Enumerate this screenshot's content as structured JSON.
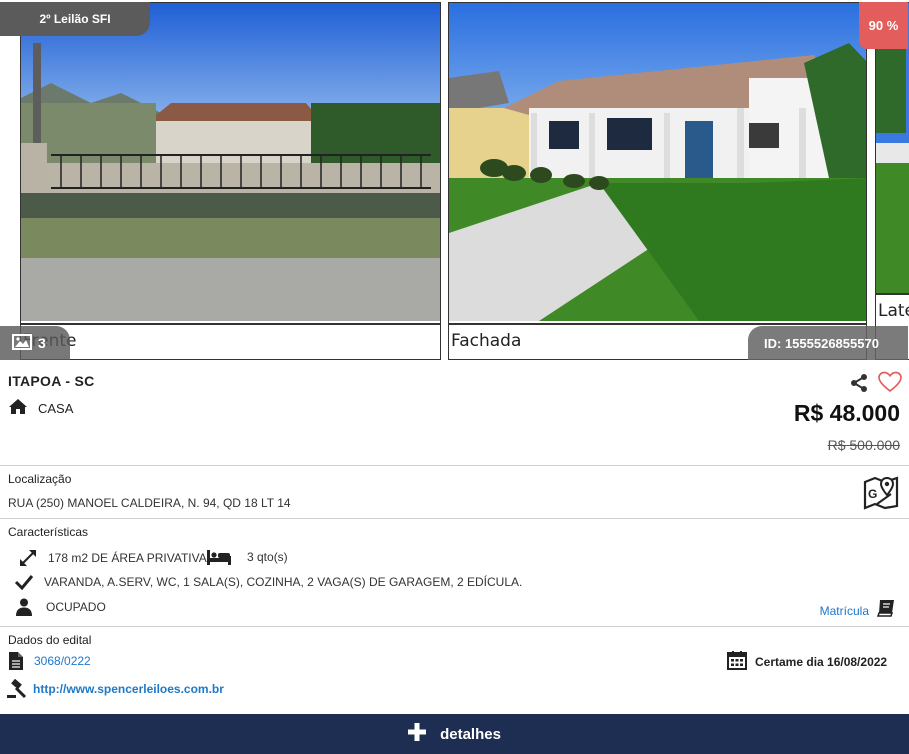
{
  "gallery": {
    "auction_ribbon": "2º Leilão SFI",
    "discount_badge": "90 %",
    "photo_count": "3",
    "id_badge": "ID: 1555526855570",
    "photos": [
      {
        "caption": "Frente",
        "icon": "house-front-photo"
      },
      {
        "caption": "Fachada",
        "icon": "house-facade-photo"
      },
      {
        "caption": "Lateral",
        "icon": "house-side-photo"
      }
    ]
  },
  "listing": {
    "city": "ITAPOA - SC",
    "property_type": "CASA",
    "price": "R$ 48.000",
    "old_price": "R$ 500.000"
  },
  "location": {
    "label": "Localização",
    "address": "RUA (250) MANOEL CALDEIRA, N. 94, QD 18 LT 14"
  },
  "features": {
    "label": "Características",
    "area": "178 m2 DE ÁREA PRIVATIVA",
    "bedrooms": "3 qto(s)",
    "amenities": "VARANDA, A.SERV, WC, 1 SALA(S), COZINHA, 2 VAGA(S) DE GARAGEM, 2 EDÍCULA.",
    "occupancy": "OCUPADO",
    "matricula_link": "Matrícula"
  },
  "edital": {
    "label": "Dados do edital",
    "number": "3068/0222",
    "website": "http://www.spencerleiloes.com.br",
    "certame": "Certame dia 16/08/2022"
  },
  "actions": {
    "details_label": "detalhes"
  },
  "colors": {
    "discount": "#e35d5d",
    "details_button": "#1d2e52",
    "link": "#1f78c8"
  }
}
